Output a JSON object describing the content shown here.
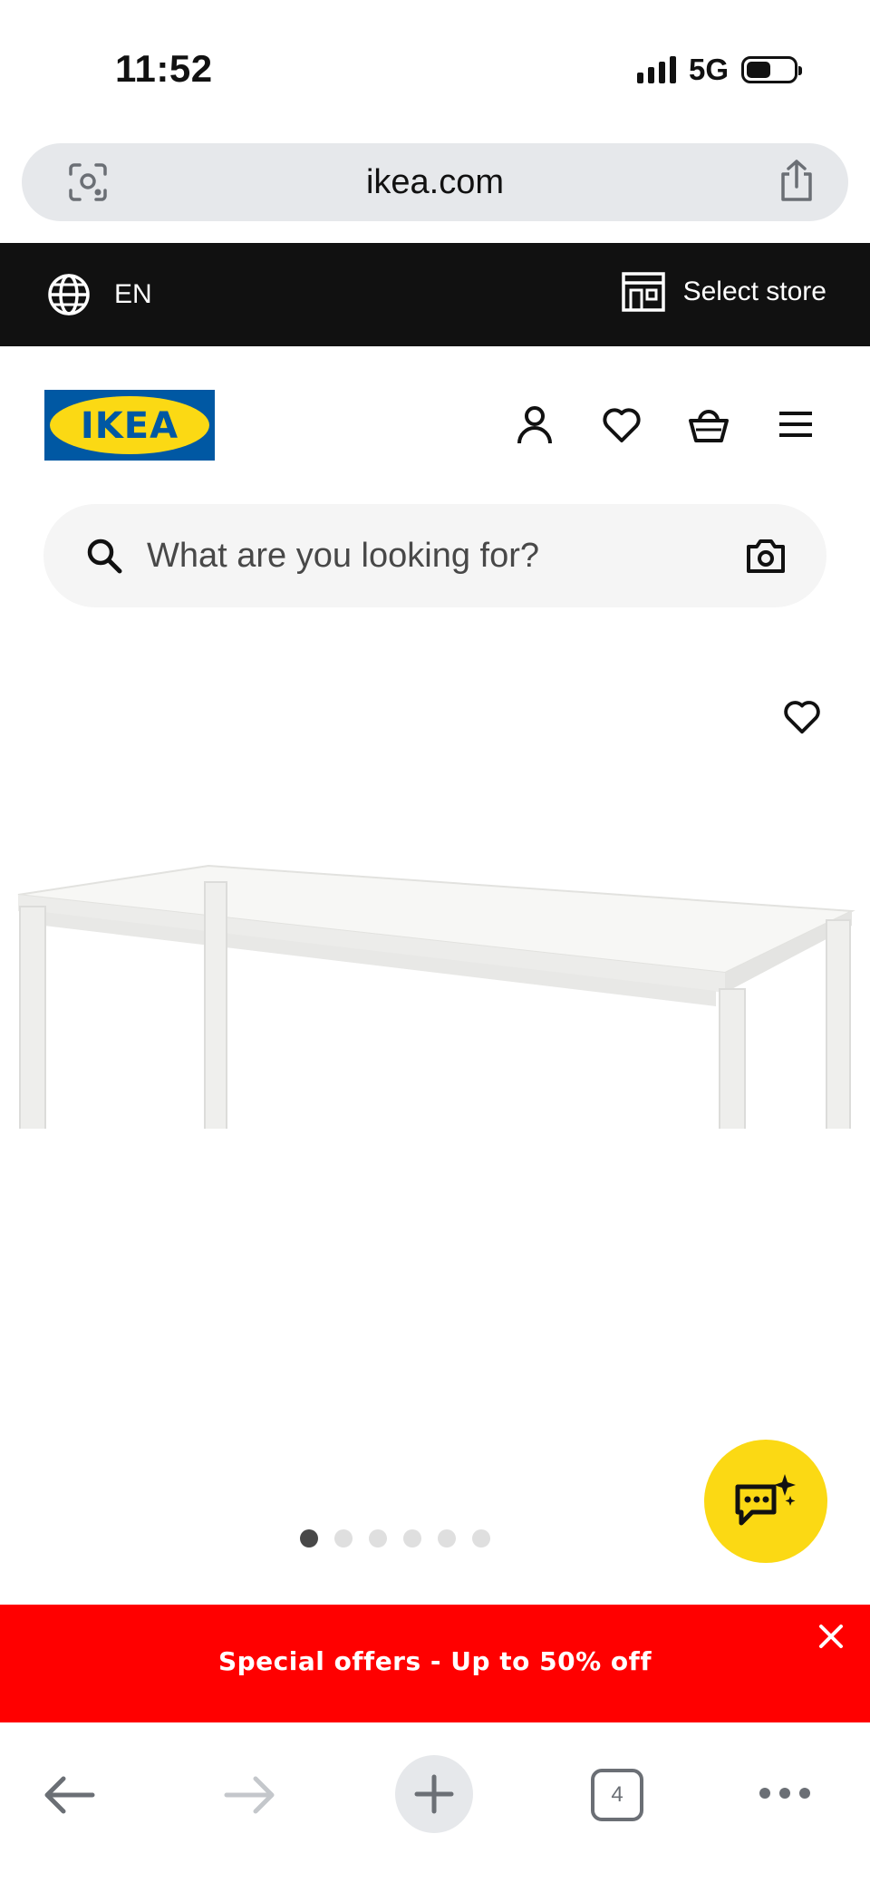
{
  "status_bar": {
    "time": "11:52",
    "network": "5G"
  },
  "browser": {
    "url": "ikea.com",
    "tab_count": "4",
    "icons": {
      "lens": "lens-icon",
      "share": "share-icon",
      "back": "back-arrow-icon",
      "forward": "forward-arrow-icon",
      "new_tab": "plus-icon",
      "more": "more-icon"
    }
  },
  "topbar": {
    "language": "EN",
    "store_label": "Select store",
    "icons": {
      "language": "globe-icon",
      "store": "store-icon"
    }
  },
  "header": {
    "logo_text": "IKEA",
    "icons": [
      "account-icon",
      "heart-icon",
      "basket-icon",
      "menu-icon"
    ]
  },
  "search": {
    "placeholder": "What are you looking for?"
  },
  "product": {
    "image_alt": "white dining table",
    "carousel": {
      "total": 6,
      "active_index": 0
    }
  },
  "promo": {
    "text": "Special offers - Up to 50% off"
  },
  "colors": {
    "ikea_blue": "#0058a3",
    "ikea_yellow": "#fbd914",
    "promo_red": "#ff0000",
    "topbar_black": "#111111"
  }
}
